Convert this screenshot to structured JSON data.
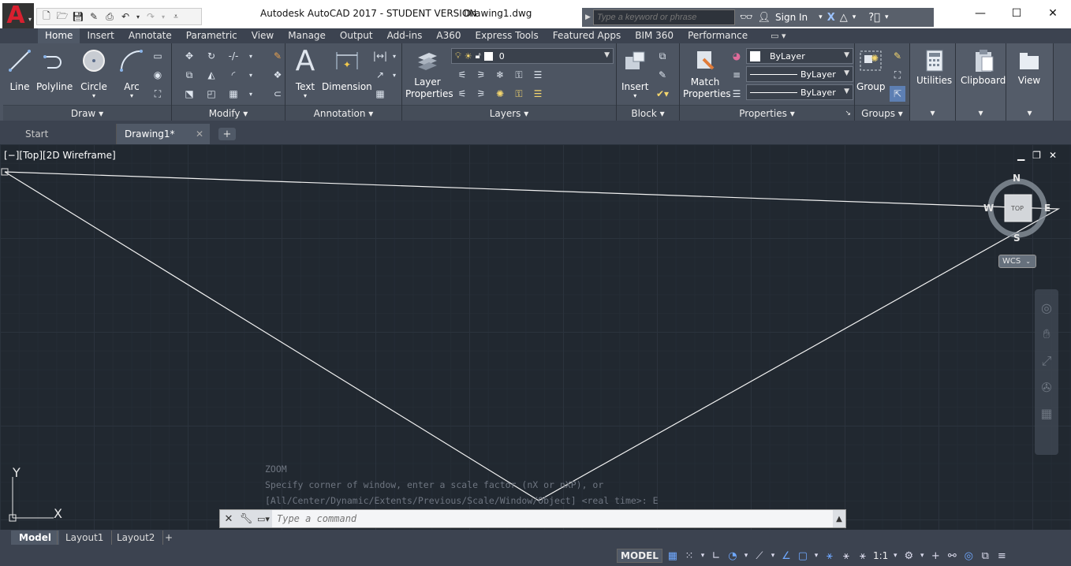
{
  "window": {
    "app_title": "Autodesk AutoCAD 2017 - STUDENT VERSION",
    "file_name": "Drawing1.dwg",
    "app_button": "A"
  },
  "infocenter": {
    "search_placeholder": "Type a keyword or phrase",
    "sign_in": "Sign In"
  },
  "ribbon_tabs": [
    "Home",
    "Insert",
    "Annotate",
    "Parametric",
    "View",
    "Manage",
    "Output",
    "Add-ins",
    "A360",
    "Express Tools",
    "Featured Apps",
    "BIM 360",
    "Performance"
  ],
  "active_ribbon_tab": "Home",
  "panels": {
    "draw": {
      "title": "Draw",
      "tools": [
        "Line",
        "Polyline",
        "Circle",
        "Arc"
      ]
    },
    "modify": {
      "title": "Modify"
    },
    "annotation": {
      "title": "Annotation",
      "tools": [
        "Text",
        "Dimension"
      ]
    },
    "layers": {
      "title": "Layers",
      "tool": "Layer Properties",
      "current_layer": "0"
    },
    "block": {
      "title": "Block",
      "tool": "Insert"
    },
    "properties": {
      "title": "Properties",
      "tool": "Match Properties",
      "color": "ByLayer",
      "linetype": "ByLayer",
      "lineweight": "ByLayer"
    },
    "groups": {
      "title": "Groups",
      "tool": "Group"
    },
    "utilities": {
      "title": "Utilities"
    },
    "clipboard": {
      "title": "Clipboard"
    },
    "view": {
      "title": "View"
    }
  },
  "file_tabs": [
    {
      "label": "Start"
    },
    {
      "label": "Drawing1*"
    }
  ],
  "viewport": {
    "label": "[−][Top][2D Wireframe]",
    "viewcube": {
      "n": "N",
      "s": "S",
      "e": "E",
      "w": "W",
      "face": "TOP"
    },
    "wcs": "WCS",
    "ucs_x": "X",
    "ucs_y": "Y"
  },
  "command": {
    "history": [
      "ZOOM",
      "Specify corner of window, enter a scale factor (nX or nXP), or",
      "[All/Center/Dynamic/Extents/Previous/Scale/Window/Object] <real time>: E"
    ],
    "placeholder": "Type a command"
  },
  "layout_tabs": [
    "Model",
    "Layout1",
    "Layout2"
  ],
  "status": {
    "model": "MODEL",
    "scale": "1:1"
  },
  "colors": {
    "canvas": "#212830",
    "ribbon": "#4d5562",
    "accent_red": "#d8202f",
    "line": "#ffffff"
  }
}
